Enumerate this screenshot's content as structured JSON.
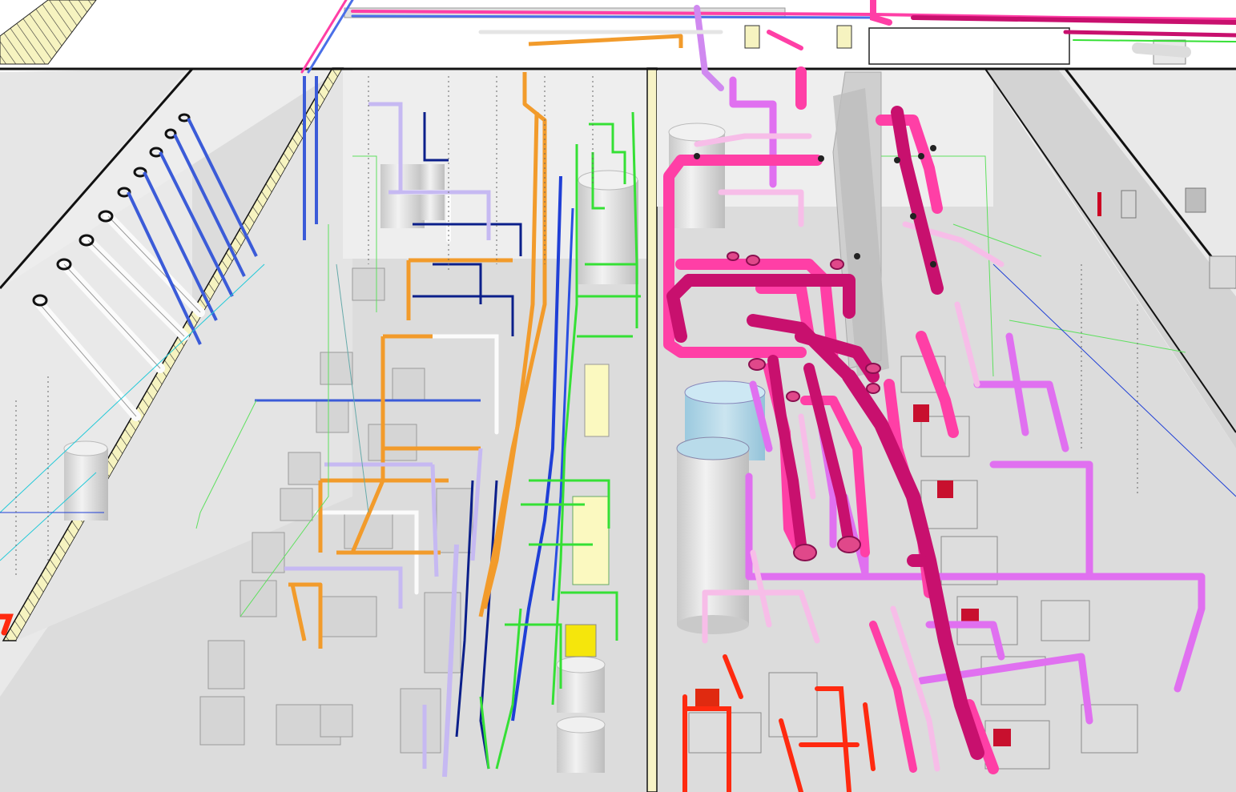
{
  "viewport": {
    "label": ""
  },
  "colors": {
    "floor": "#d9d9d9",
    "wall": "#ececec",
    "wall_shade": "#cfcfcf",
    "wall_top": "#000000",
    "hatch": "#f3f0b0",
    "chilled_water": "#ff3fa6",
    "process": "#c8106e",
    "condenser": "#e070f0",
    "lavender": "#c6b9f2",
    "orange": "#f29b2b",
    "green": "#35e035",
    "blue": "#1f3fd6",
    "navy": "#0b1f8a",
    "light_pink": "#f7bde8",
    "red": "#ff2a10",
    "white_pipe": "#fafafa",
    "tank": "#dedede",
    "tank_blue": "#a9d6ea",
    "duct": "#c9c9c9",
    "yellow": "#f5e60c"
  },
  "systems": [
    {
      "id": "chilled_water",
      "icon": "pipe-icon"
    },
    {
      "id": "process",
      "icon": "pipe-icon"
    },
    {
      "id": "condenser",
      "icon": "pipe-icon"
    },
    {
      "id": "orange",
      "icon": "pipe-icon"
    },
    {
      "id": "green",
      "icon": "pipe-icon"
    },
    {
      "id": "blue",
      "icon": "pipe-icon"
    },
    {
      "id": "red",
      "icon": "pipe-icon"
    }
  ]
}
